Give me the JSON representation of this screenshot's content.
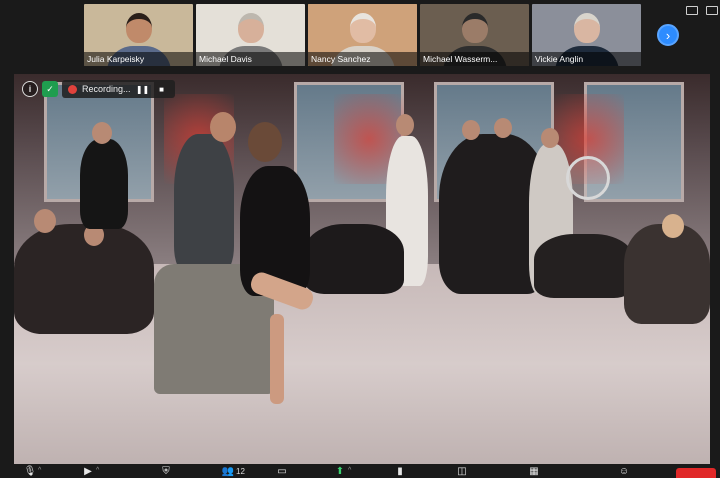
{
  "gallery": {
    "participants": [
      {
        "name": "Julia Karpeisky",
        "bg": "#c9b89a",
        "skin": "#c08a6a",
        "hair": "#2a1f1a",
        "shirt": "#5a6a8a"
      },
      {
        "name": "Michael Davis",
        "bg": "#e4e0d8",
        "skin": "#d7b09a",
        "hair": "#bdb7ae",
        "shirt": "#7a7a7a"
      },
      {
        "name": "Nancy Sanchez",
        "bg": "#cfa27a",
        "skin": "#e1bca4",
        "hair": "#e8e4de",
        "shirt": "#d9d2c8"
      },
      {
        "name": "Michael Wasserm...",
        "bg": "#6b5e50",
        "skin": "#9b7c68",
        "hair": "#2a2a2a",
        "shirt": "#2e2e2e"
      },
      {
        "name": "Vickie Anglin",
        "bg": "#8b8f9a",
        "skin": "#d9b6a2",
        "hair": "#d8d4cc",
        "shirt": "#1e2b3c"
      }
    ],
    "speaking_index": 2,
    "next_icon": "chevron-right-icon"
  },
  "recording": {
    "label": "Recording...",
    "info_icon": "info-icon",
    "shield_icon": "shield-check-icon",
    "pause_icon": "pause-icon",
    "stop_icon": "stop-icon",
    "dot_color": "#e0423c"
  },
  "toolbar": {
    "items": [
      {
        "icon": "microphone-icon",
        "glyph": "🎙",
        "caret": true
      },
      {
        "icon": "video-camera-icon",
        "glyph": "▶",
        "caret": true
      },
      {
        "icon": "security-shield-icon",
        "glyph": "⛨",
        "caret": false
      },
      {
        "icon": "participants-icon",
        "glyph": "👥",
        "count": "12",
        "caret": false
      },
      {
        "icon": "chat-icon",
        "glyph": "▭",
        "caret": false
      },
      {
        "icon": "share-screen-icon",
        "glyph": "⬆",
        "caret": true
      },
      {
        "icon": "polls-icon",
        "glyph": "▮",
        "caret": false
      },
      {
        "icon": "record-icon",
        "glyph": "◫",
        "caret": false
      },
      {
        "icon": "apps-icon",
        "glyph": "▦",
        "caret": false
      },
      {
        "icon": "reactions-icon",
        "glyph": "☺",
        "caret": false
      }
    ],
    "end_color": "#e02828"
  },
  "colors": {
    "accent_blue": "#2d8cff",
    "share_green": "#3bd16f",
    "active_speaker": "#f2e84a"
  }
}
